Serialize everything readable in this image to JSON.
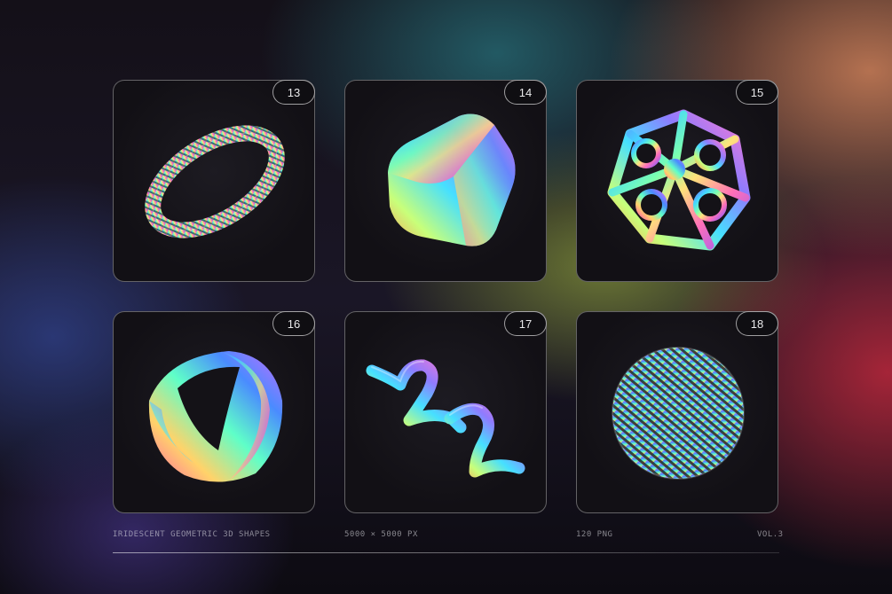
{
  "cards": [
    {
      "number": "13",
      "shape": "coiled-torus"
    },
    {
      "number": "14",
      "shape": "rounded-cube"
    },
    {
      "number": "15",
      "shape": "lattice-polyhedron"
    },
    {
      "number": "16",
      "shape": "twisted-ring"
    },
    {
      "number": "17",
      "shape": "curly-tubes"
    },
    {
      "number": "18",
      "shape": "ribbed-sphere"
    }
  ],
  "footer": {
    "title": "IRIDESCENT GEOMETRIC 3D SHAPES",
    "dimensions": "5000 × 5000 PX",
    "count": "120 PNG",
    "volume": "VOL.3"
  },
  "colors": {
    "card_border": "#8a8a90",
    "card_background": "#141217",
    "text": "#e8e8ea"
  }
}
